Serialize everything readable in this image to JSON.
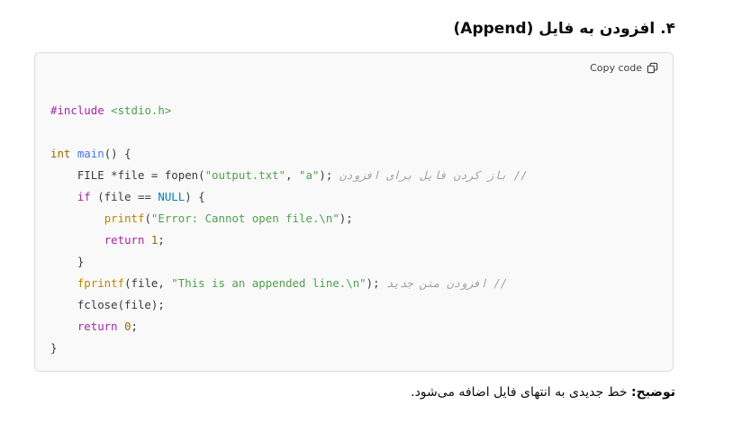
{
  "heading": "۴. افزودن به فایل (Append)",
  "code_block": {
    "copy_label": "Copy code",
    "copy_icon": "copy-icon",
    "lines": [
      [
        {
          "t": "#include ",
          "c": "kw"
        },
        {
          "t": "<stdio.h>",
          "c": "str"
        }
      ],
      [],
      [
        {
          "t": "int ",
          "c": "type"
        },
        {
          "t": "main",
          "c": "fn"
        },
        {
          "t": "() {",
          "c": "plain"
        }
      ],
      [
        {
          "t": "    FILE *file = fopen(",
          "c": "plain"
        },
        {
          "t": "\"output.txt\"",
          "c": "str"
        },
        {
          "t": ", ",
          "c": "plain"
        },
        {
          "t": "\"a\"",
          "c": "str"
        },
        {
          "t": "); ",
          "c": "plain"
        },
        {
          "t": "// باز کردن فایل برای افزودن",
          "c": "cm"
        }
      ],
      [
        {
          "t": "    ",
          "c": "plain"
        },
        {
          "t": "if",
          "c": "kw"
        },
        {
          "t": " (file == ",
          "c": "plain"
        },
        {
          "t": "NULL",
          "c": "const"
        },
        {
          "t": ") {",
          "c": "plain"
        }
      ],
      [
        {
          "t": "        ",
          "c": "plain"
        },
        {
          "t": "printf",
          "c": "call"
        },
        {
          "t": "(",
          "c": "plain"
        },
        {
          "t": "\"Error: Cannot open file.\\n\"",
          "c": "str"
        },
        {
          "t": ");",
          "c": "plain"
        }
      ],
      [
        {
          "t": "        ",
          "c": "plain"
        },
        {
          "t": "return",
          "c": "kw"
        },
        {
          "t": " ",
          "c": "plain"
        },
        {
          "t": "1",
          "c": "num"
        },
        {
          "t": ";",
          "c": "plain"
        }
      ],
      [
        {
          "t": "    }",
          "c": "plain"
        }
      ],
      [
        {
          "t": "    ",
          "c": "plain"
        },
        {
          "t": "fprintf",
          "c": "call"
        },
        {
          "t": "(file, ",
          "c": "plain"
        },
        {
          "t": "\"This is an appended line.\\n\"",
          "c": "str"
        },
        {
          "t": "); ",
          "c": "plain"
        },
        {
          "t": "// افزودن متن جدید",
          "c": "cm"
        }
      ],
      [
        {
          "t": "    fclose(file);",
          "c": "plain"
        }
      ],
      [
        {
          "t": "    ",
          "c": "plain"
        },
        {
          "t": "return",
          "c": "kw"
        },
        {
          "t": " ",
          "c": "plain"
        },
        {
          "t": "0",
          "c": "num"
        },
        {
          "t": ";",
          "c": "plain"
        }
      ],
      [
        {
          "t": "}",
          "c": "plain"
        }
      ]
    ]
  },
  "explanation": {
    "label": "توضیح:",
    "text": " خط جدیدی به انتهای فایل اضافه می‌شود."
  }
}
